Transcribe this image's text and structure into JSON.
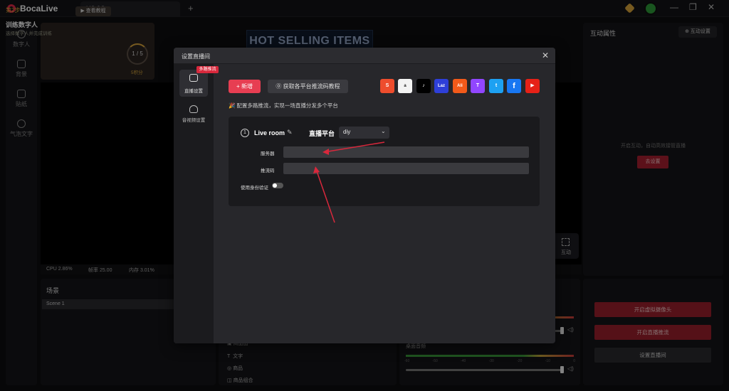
{
  "app": {
    "title": "BocaLive",
    "tab": "US 3C",
    "tab_add": "+",
    "win_min": "—",
    "win_restore": "❐",
    "win_close": "✕"
  },
  "sidebar": {
    "items": [
      {
        "label": "数字人",
        "icon": "user-icon"
      },
      {
        "label": "背景",
        "icon": "background-icon"
      },
      {
        "label": "贴纸",
        "icon": "sticker-icon"
      },
      {
        "label": "气泡文字",
        "icon": "bubble-text-icon"
      }
    ]
  },
  "step_card": {
    "step": "第2步",
    "tutorial": "▶ 查看教程",
    "title": "训练数字人",
    "subtitle": "选择数字人并完成训练",
    "progress": "1 / 5",
    "points": "5积分"
  },
  "preview": {
    "banner": "HOT SELLING ITEMS",
    "interact": "互动"
  },
  "stats": {
    "cpu": "CPU 2.86%",
    "fps": "帧率 25.00",
    "mem": "内存 3.01%"
  },
  "right_panel": {
    "title": "互动属性",
    "settings": "⊕ 互动设置",
    "hint": "开启互动，自动高效接管直播",
    "goto": "去设置"
  },
  "scene_panel": {
    "title": "场景",
    "scene": "Scene 1"
  },
  "sources": {
    "items": [
      "商品图",
      "文字",
      "商品",
      "商品组合"
    ]
  },
  "audio": {
    "label": "桌面音频",
    "ticks": [
      "-60",
      "-50",
      "-40",
      "-30",
      "-20",
      "-10",
      "0"
    ]
  },
  "actions": {
    "virtual_cam": "开启虚拟摄像头",
    "start_push": "开启直播推流",
    "setup_room": "设置直播间"
  },
  "modal": {
    "title": "设置直播间",
    "close": "✕",
    "nav": {
      "live": "直播设置",
      "multi_badge": "多路推流",
      "av": "音视频设置"
    },
    "add": "+ 新增",
    "tutorial": "⓪ 获取各平台推流码教程",
    "hint": "🎉 配置多路推流，实现一场直播分发多个平台",
    "platforms": [
      {
        "name": "shopee-icon",
        "glyph": "S",
        "color": "#ee4d2d"
      },
      {
        "name": "amazon-icon",
        "glyph": "a",
        "color": "#f3f3f3"
      },
      {
        "name": "tiktok-icon",
        "glyph": "♪",
        "color": "#000000"
      },
      {
        "name": "lazada-icon",
        "glyph": "Laz",
        "color": "#2e3fd8"
      },
      {
        "name": "aliexpress-icon",
        "glyph": "Ali",
        "color": "#f25a1a"
      },
      {
        "name": "twitch-icon",
        "glyph": "T",
        "color": "#9146ff"
      },
      {
        "name": "twitter-icon",
        "glyph": "t",
        "color": "#1da1f2"
      },
      {
        "name": "facebook-icon",
        "glyph": "f",
        "color": "#1877f2"
      },
      {
        "name": "youtube-icon",
        "glyph": "▶",
        "color": "#e62117"
      }
    ],
    "room": {
      "number": "1",
      "name": "Live room",
      "platform_label": "直播平台",
      "platform_value": "diy",
      "server_label": "服务器",
      "server_value": "",
      "key_label": "推流码",
      "key_value": "",
      "auth_label": "使用身份验证"
    }
  }
}
